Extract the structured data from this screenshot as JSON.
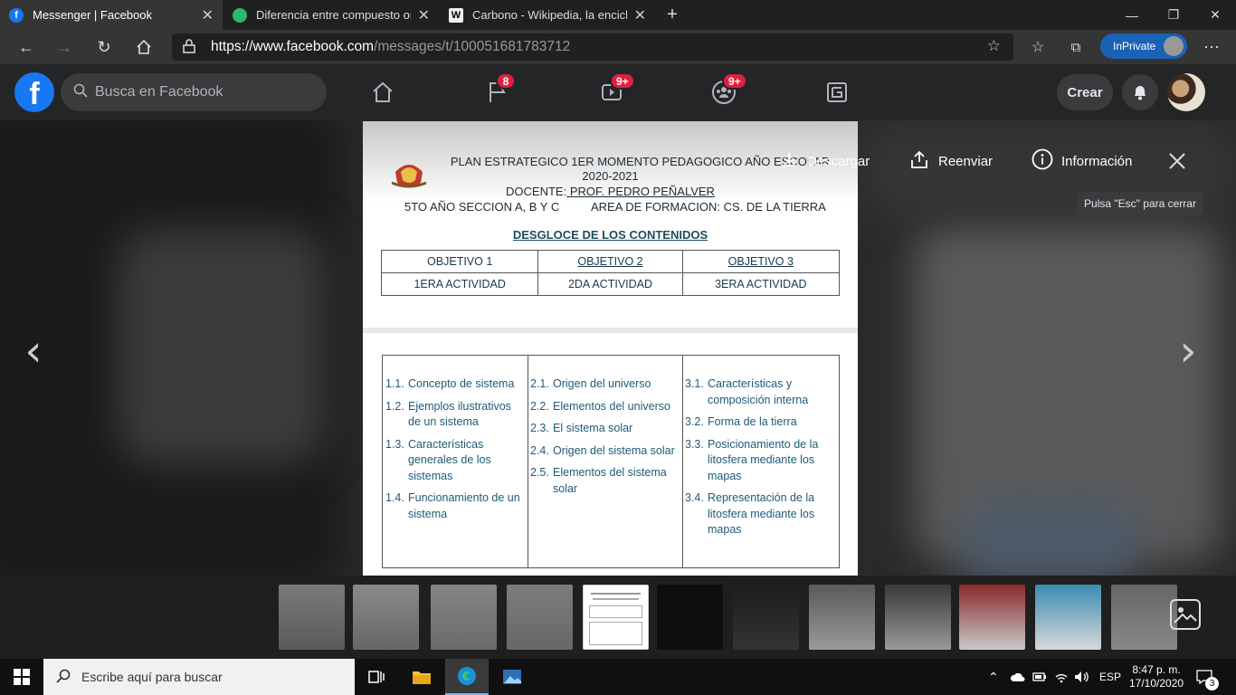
{
  "browser": {
    "tabs": [
      {
        "title": "Messenger | Facebook",
        "active": true
      },
      {
        "title": "Diferencia entre compuesto orgá",
        "active": false
      },
      {
        "title": "Carbono - Wikipedia, la enciclop",
        "active": false
      }
    ],
    "new_tab": "+",
    "url_host": "https://www.facebook.com",
    "url_path": "/messages/t/100051681783712",
    "inprivate_label": "InPrivate"
  },
  "facebook": {
    "search_placeholder": "Busca en Facebook",
    "badges": {
      "watch_pages": "8",
      "video": "9+",
      "groups": "9+"
    },
    "create_label": "Crear"
  },
  "viewer": {
    "download_label": "Descargar",
    "forward_label": "Reenviar",
    "info_label": "Información",
    "tooltip": "Pulsa \"Esc\" para cerrar"
  },
  "document": {
    "title_line1": "PLAN ESTRATEGICO 1ER MOMENTO PEDAGOGICO AÑO ESCOLAR",
    "title_line2": "2020-2021",
    "teacher_prefix": "DOCENTE:",
    "teacher_name": " PROF. PEDRO PEÑALVER",
    "section": "5TO AÑO SECCION A, B Y C",
    "area": "AREA DE FORMACION: CS. DE LA TIERRA",
    "breakdown_title": "DESGLOCE DE LOS CONTENIDOS",
    "objectives": [
      "OBJETIVO 1",
      "OBJETIVO 2",
      "OBJETIVO 3"
    ],
    "activities": [
      "1ERA ACTIVIDAD",
      "2DA ACTIVIDAD",
      "3ERA ACTIVIDAD"
    ],
    "col1": [
      {
        "n": "1.1.",
        "t": "Concepto de sistema"
      },
      {
        "n": "1.2.",
        "t": "Ejemplos ilustrativos de un sistema"
      },
      {
        "n": "1.3.",
        "t": "Características generales de los sistemas"
      },
      {
        "n": "1.4.",
        "t": "Funcionamiento de un sistema"
      }
    ],
    "col2": [
      {
        "n": "2.1.",
        "t": "Origen del universo"
      },
      {
        "n": "2.2.",
        "t": "Elementos del universo"
      },
      {
        "n": "2.3.",
        "t": "El sistema solar"
      },
      {
        "n": "2.4.",
        "t": "Origen del sistema solar"
      },
      {
        "n": "2.5.",
        "t": "Elementos del sistema solar"
      }
    ],
    "col3": [
      {
        "n": "3.1.",
        "t": "Características y composición interna"
      },
      {
        "n": "3.2.",
        "t": "Forma de la tierra"
      },
      {
        "n": "3.3.",
        "t": "Posicionamiento de la litosfera mediante los mapas"
      },
      {
        "n": "3.4.",
        "t": "Representación de la litosfera mediante los mapas"
      }
    ]
  },
  "taskbar": {
    "search_placeholder": "Escribe aquí para buscar",
    "language": "ESP",
    "time": "8:47 p. m.",
    "date": "17/10/2020",
    "notifications": "3"
  },
  "colors": {
    "facebook_blue": "#1877f2",
    "badge_red": "#e41e3f",
    "inprivate": "#1a62b6"
  }
}
